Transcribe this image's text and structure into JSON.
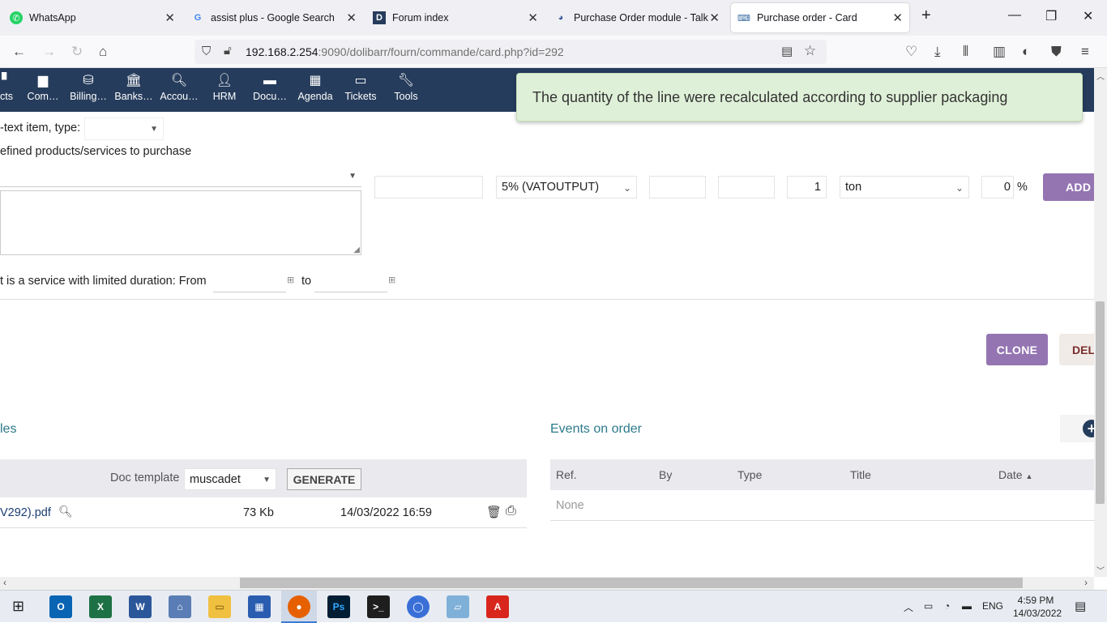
{
  "browser": {
    "tabs": [
      {
        "title": "WhatsApp",
        "icon": "whatsapp-icon"
      },
      {
        "title": "assist plus - Google Search",
        "icon": "google-icon"
      },
      {
        "title": "Forum index",
        "icon": "dolibarr-forum-icon"
      },
      {
        "title": "Purchase Order module - Talk b",
        "icon": "discourse-icon"
      },
      {
        "title": "Purchase order - Card",
        "icon": "dolibarr-icon"
      }
    ],
    "url_host": "192.168.2.254",
    "url_rest": ":9090/dolibarr/fourn/commande/card.php?id=292"
  },
  "menu": {
    "items": [
      {
        "label": "ects",
        "icon": "projects-icon"
      },
      {
        "label": "Com…",
        "icon": "commerce-icon"
      },
      {
        "label": "Billing…",
        "icon": "billing-icon"
      },
      {
        "label": "Banks…",
        "icon": "bank-icon"
      },
      {
        "label": "Accou…",
        "icon": "accounting-icon"
      },
      {
        "label": "HRM",
        "icon": "hrm-icon"
      },
      {
        "label": "Docu…",
        "icon": "documents-icon"
      },
      {
        "label": "Agenda",
        "icon": "agenda-icon"
      },
      {
        "label": "Tickets",
        "icon": "tickets-icon"
      },
      {
        "label": "Tools",
        "icon": "tools-icon"
      }
    ]
  },
  "toast": {
    "message": "The quantity of the line were recalculated according to supplier packaging"
  },
  "addline": {
    "freetext_label": "-text item, type:",
    "predefined_label": "efined products/services to purchase",
    "vat_value": "5% (VATOUTPUT)",
    "qty_value": "1",
    "unit_value": "ton",
    "discount_value": "0",
    "discount_suffix": "%",
    "add_label": "ADD",
    "duration_label": "t is a service with limited duration: From",
    "duration_to": "to"
  },
  "actions": {
    "clone_label": "CLONE",
    "delete_label": "DEL"
  },
  "files": {
    "title": "les",
    "doc_template_label": "Doc template",
    "doc_template_value": "muscadet",
    "generate_label": "GENERATE",
    "row": {
      "filename": "V292).pdf",
      "size": "73 Kb",
      "date": "14/03/2022 16:59"
    }
  },
  "events": {
    "title": "Events on order",
    "columns": [
      "Ref.",
      "By",
      "Type",
      "Title",
      "Date"
    ],
    "empty": "None"
  },
  "taskbar": {
    "language": "ENG",
    "time": "4:59 PM",
    "date": "14/03/2022"
  }
}
